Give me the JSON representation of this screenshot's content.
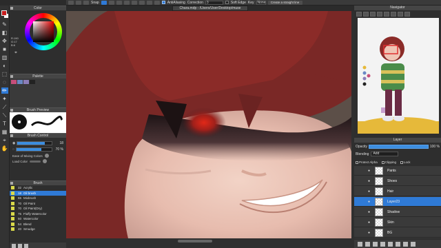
{
  "toolbar": {
    "snap_label": "Snap",
    "antialias_label": "AntiAliasing",
    "correction_label": "Correction",
    "correction_value": "3",
    "soft_edge_label": "Soft Edge",
    "key_label": "Key",
    "key_value": "None",
    "straight_line_label": "Create a straight line"
  },
  "file_tab": {
    "title": "Chara.mdp - /Users/User/Desktop/muse"
  },
  "color_panel": {
    "title": "Color",
    "r": "R:190",
    "g": "G:17",
    "b": "B:6",
    "fg_color": "#c81e1e",
    "bg_color": "#ffffff"
  },
  "palette_panel": {
    "title": "Palette"
  },
  "brush_preview_panel": {
    "title": "Brush Preview"
  },
  "brush_control_panel": {
    "title": "Brush Control",
    "size_value": "18",
    "size_fraction": 0.8,
    "opacity_value": "70 %",
    "opacity_fraction": 0.7,
    "ease_mixing_label": "Ease of Mixing Colors",
    "load_color_label": "Load Color"
  },
  "brush_panel": {
    "title": "Brush",
    "items": [
      {
        "size": "32",
        "name": "Acrylic"
      },
      {
        "size": "18",
        "name": "Oil brush",
        "selected": true
      },
      {
        "size": "55",
        "name": "Mixbrush"
      },
      {
        "size": "70",
        "name": "Oil Paint"
      },
      {
        "size": "70",
        "name": "Oil Paint(Dry)"
      },
      {
        "size": "75",
        "name": "Fluffy Watercolor"
      },
      {
        "size": "50",
        "name": "Watercolor"
      },
      {
        "size": "54",
        "name": "Blend"
      },
      {
        "size": "40",
        "name": "Smudge"
      }
    ]
  },
  "navigator": {
    "title": "Navigator"
  },
  "layer_panel": {
    "title": "Layer",
    "opacity_label": "Opacity",
    "opacity_value": "100 %",
    "blending_label": "Blending",
    "blending_value": "Add",
    "protect_alpha_label": "Protect Alpha",
    "clipping_label": "Clipping",
    "lock_label": "Lock",
    "layers": [
      {
        "name": "Pants"
      },
      {
        "name": "Shoes"
      },
      {
        "name": "Hair"
      },
      {
        "name": "Layer23",
        "selected": true
      },
      {
        "name": "Shadow"
      },
      {
        "name": "Skin"
      },
      {
        "name": "BG"
      }
    ]
  }
}
